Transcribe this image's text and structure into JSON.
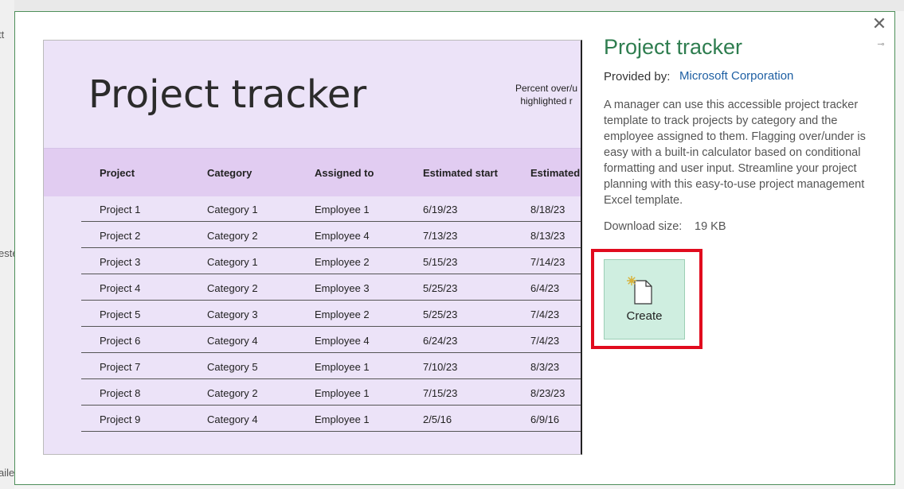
{
  "background": {
    "left_fragments": [
      "tt",
      "este",
      "aile"
    ]
  },
  "dialog": {
    "close_label": "✕",
    "pin_label": "⊸"
  },
  "preview": {
    "title": "Project tracker",
    "note_line1": "Percent over/u",
    "note_line2": "highlighted r",
    "columns": [
      "Project",
      "Category",
      "Assigned to",
      "Estimated start",
      "Estimated"
    ],
    "rows": [
      [
        "Project 1",
        "Category 1",
        "Employee 1",
        "6/19/23",
        "8/18/23"
      ],
      [
        "Project 2",
        "Category 2",
        "Employee 4",
        "7/13/23",
        "8/13/23"
      ],
      [
        "Project 3",
        "Category 1",
        "Employee 2",
        "5/15/23",
        "7/14/23"
      ],
      [
        "Project 4",
        "Category 2",
        "Employee 3",
        "5/25/23",
        "6/4/23"
      ],
      [
        "Project 5",
        "Category 3",
        "Employee 2",
        "5/25/23",
        "7/4/23"
      ],
      [
        "Project 6",
        "Category 4",
        "Employee 4",
        "6/24/23",
        "7/4/23"
      ],
      [
        "Project 7",
        "Category 5",
        "Employee 1",
        "7/10/23",
        "8/3/23"
      ],
      [
        "Project 8",
        "Category 2",
        "Employee 1",
        "7/15/23",
        "8/23/23"
      ],
      [
        "Project 9",
        "Category 4",
        "Employee 1",
        "2/5/16",
        "6/9/16"
      ]
    ]
  },
  "info": {
    "title": "Project tracker",
    "provided_by_label": "Provided by:",
    "provider": "Microsoft Corporation",
    "description": "A manager can use this accessible project tracker template to track projects by category and the employee assigned to them. Flagging over/under is easy with a built-in calculator based on conditional formatting and user input. Streamline your project planning with this easy-to-use project management Excel template.",
    "download_size_label": "Download size:",
    "download_size_value": "19 KB",
    "create_label": "Create",
    "create_icon": "new-document-icon"
  },
  "colors": {
    "accent_green": "#2e7d4f",
    "link_blue": "#1e5fa3",
    "highlight_red": "#e10b1e",
    "create_bg": "#cfeee0",
    "preview_bg": "#ece3f8",
    "preview_header_bg": "#e1ccf1"
  }
}
